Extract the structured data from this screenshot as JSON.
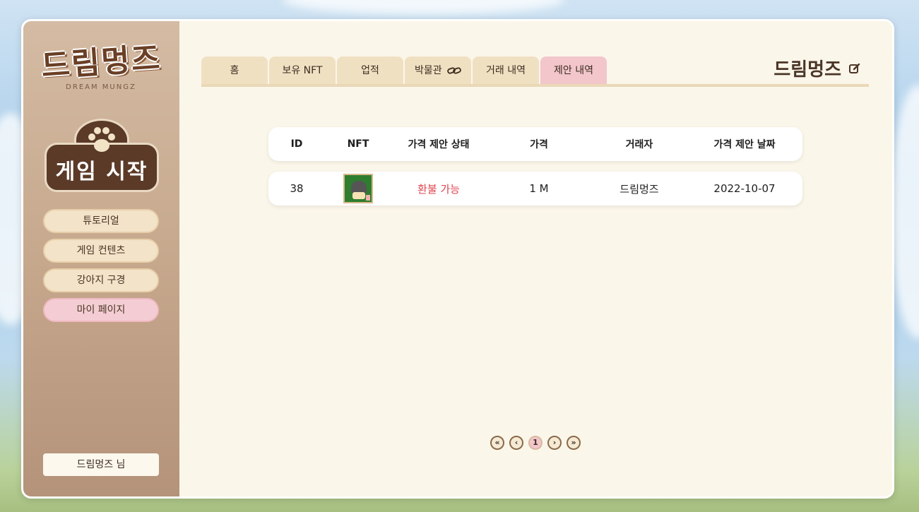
{
  "sidebar": {
    "logo_text": "드림멍즈",
    "logo_sub": "DREAM MUNGZ",
    "start_label": "게임 시작",
    "items": [
      {
        "label": "튜토리얼"
      },
      {
        "label": "게임 컨텐츠"
      },
      {
        "label": "강아지 구경"
      },
      {
        "label": "마이 페이지"
      }
    ],
    "user_label": "드림멍즈 님"
  },
  "tabs": [
    {
      "label": "홈"
    },
    {
      "label": "보유 NFT"
    },
    {
      "label": "업적"
    },
    {
      "label": "박물관"
    },
    {
      "label": "거래 내역"
    },
    {
      "label": "제안 내역"
    }
  ],
  "active_tab": "제안 내역",
  "brand": {
    "name": "드림멍즈",
    "edit_icon": "edit-icon"
  },
  "table": {
    "headers": [
      "ID",
      "NFT",
      "가격 제안 상태",
      "가격",
      "거래자",
      "가격 제안 날짜"
    ],
    "rows": [
      {
        "id": "38",
        "nft": "dog-thumbnail",
        "status": "환불 가능",
        "price": "1 M",
        "trader": "드림멍즈",
        "date": "2022-10-07"
      }
    ]
  },
  "pagination": {
    "first": "«",
    "prev": "‹",
    "current": "1",
    "next": "›",
    "last": "»"
  },
  "colors": {
    "accent_pink": "#f2c6cb",
    "tab_bg": "#f0e0c2",
    "status_red": "#e0454f",
    "sidebar_brown": "#c6a88d"
  }
}
